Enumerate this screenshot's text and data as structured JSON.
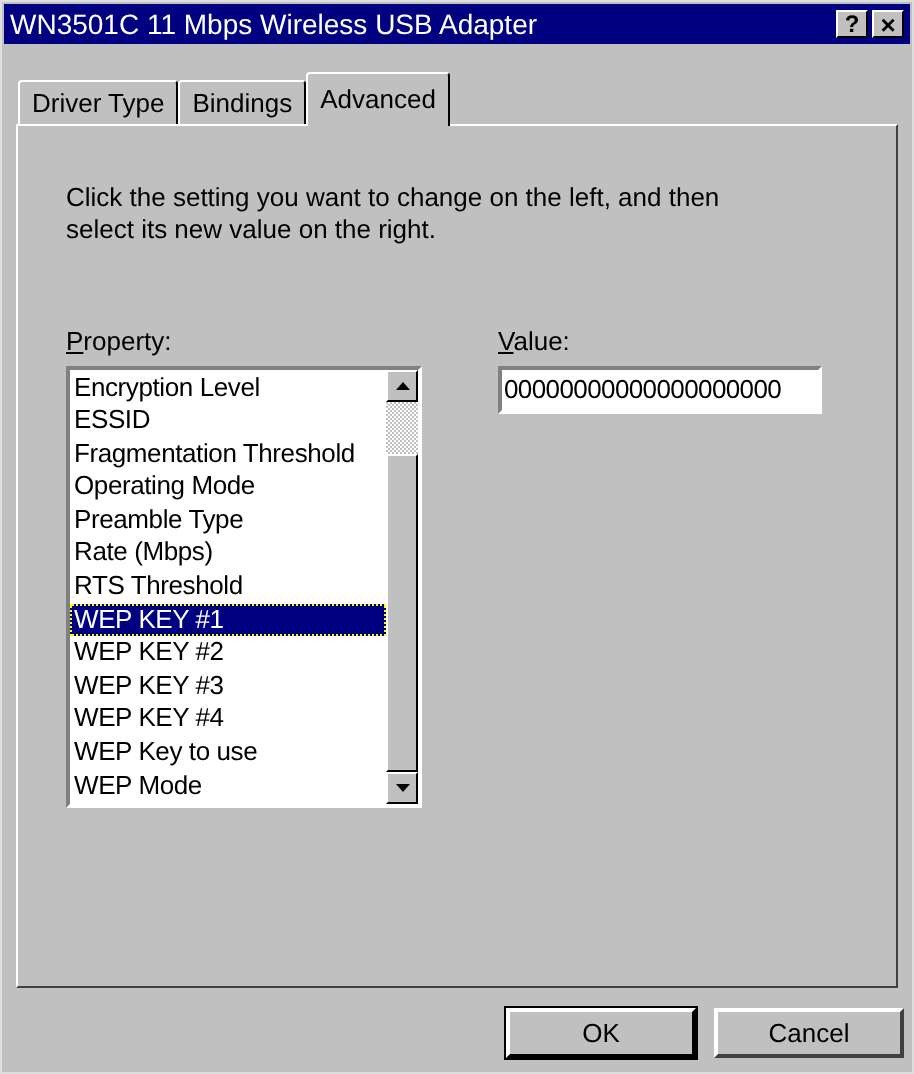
{
  "window": {
    "title": "WN3501C 11 Mbps Wireless USB Adapter",
    "title_buttons": [
      "?",
      "×"
    ]
  },
  "tabs": [
    {
      "label": "Driver Type",
      "selected": false
    },
    {
      "label": "Bindings",
      "selected": false
    },
    {
      "label": "Advanced",
      "selected": true
    }
  ],
  "instructions": "Click the setting you want to change on the left, and then select its new value on the right.",
  "property": {
    "label": "Property:",
    "items": [
      {
        "label": "Encryption Level",
        "selected": false
      },
      {
        "label": "ESSID",
        "selected": false
      },
      {
        "label": "Fragmentation Threshold",
        "selected": false
      },
      {
        "label": "Operating Mode",
        "selected": false
      },
      {
        "label": "Preamble Type",
        "selected": false
      },
      {
        "label": "Rate (Mbps)",
        "selected": false
      },
      {
        "label": "RTS Threshold",
        "selected": false
      },
      {
        "label": "WEP KEY #1",
        "selected": true
      },
      {
        "label": "WEP KEY #2",
        "selected": false
      },
      {
        "label": "WEP KEY #3",
        "selected": false
      },
      {
        "label": "WEP KEY #4",
        "selected": false
      },
      {
        "label": "WEP Key to use",
        "selected": false
      },
      {
        "label": "WEP Mode",
        "selected": false
      }
    ]
  },
  "value": {
    "label": "Value:",
    "value": "00000000000000000000"
  },
  "buttons": [
    {
      "label": "OK",
      "default": true
    },
    {
      "label": "Cancel",
      "default": false
    }
  ]
}
